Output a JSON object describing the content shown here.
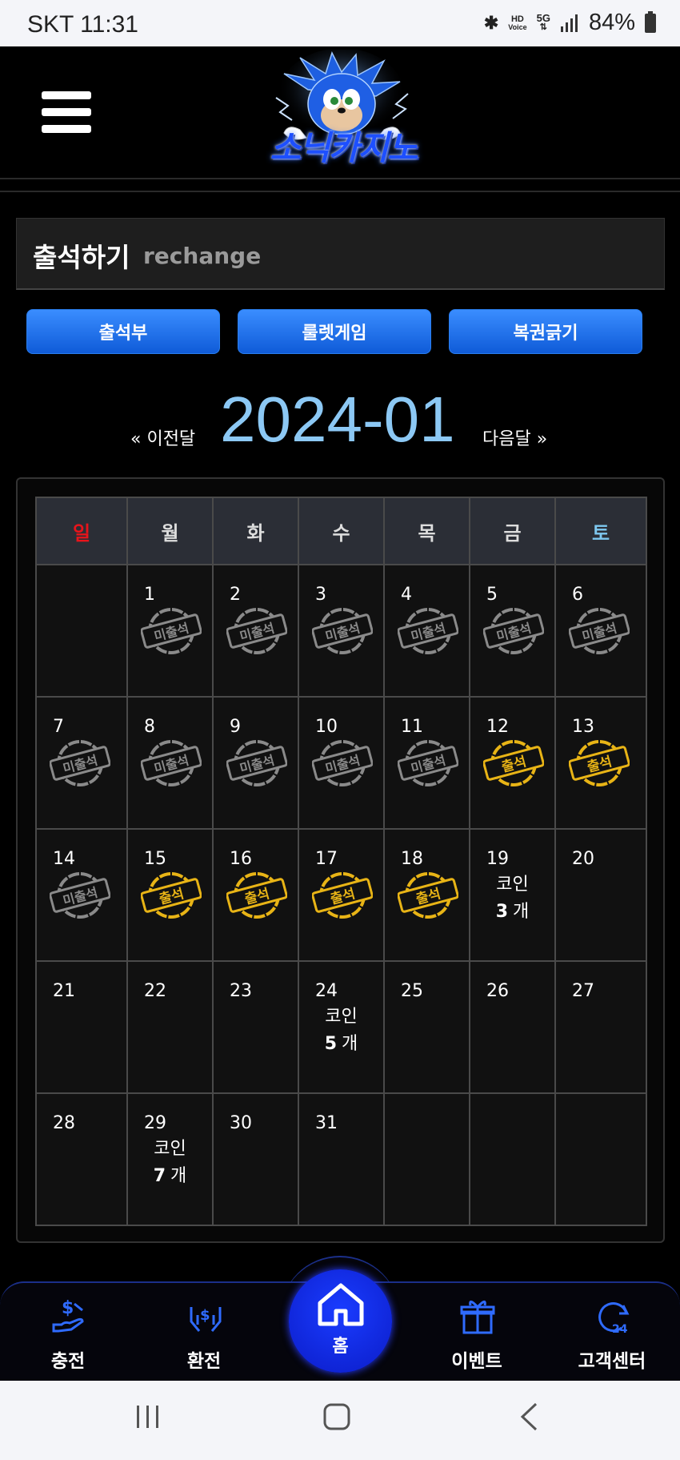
{
  "status_bar": {
    "carrier_time": "SKT 11:31",
    "hd_label": "HD",
    "voice_label": "Voice",
    "net_label": "5G",
    "battery": "84%"
  },
  "header": {
    "logo_text": "소닉카지노"
  },
  "page": {
    "title": "출석하기",
    "subtitle": "rechange"
  },
  "tabs": [
    {
      "label": "출석부"
    },
    {
      "label": "룰렛게임"
    },
    {
      "label": "복권긁기"
    }
  ],
  "month_nav": {
    "prev": "« 이전달",
    "current": "2024-01",
    "next": "다음달 »"
  },
  "calendar": {
    "weekdays": [
      "일",
      "월",
      "화",
      "수",
      "목",
      "금",
      "토"
    ],
    "weekday_colors": {
      "sun": "#e8141b",
      "sat": "#7ec8f0"
    },
    "stamp_absent_label": "미출석",
    "stamp_present_label": "출석",
    "coin_label": "코인",
    "coin_unit": "개",
    "weeks": [
      [
        {
          "day": ""
        },
        {
          "day": "1",
          "stamp": "absent"
        },
        {
          "day": "2",
          "stamp": "absent"
        },
        {
          "day": "3",
          "stamp": "absent"
        },
        {
          "day": "4",
          "stamp": "absent"
        },
        {
          "day": "5",
          "stamp": "absent"
        },
        {
          "day": "6",
          "stamp": "absent"
        }
      ],
      [
        {
          "day": "7",
          "stamp": "absent"
        },
        {
          "day": "8",
          "stamp": "absent"
        },
        {
          "day": "9",
          "stamp": "absent"
        },
        {
          "day": "10",
          "stamp": "absent"
        },
        {
          "day": "11",
          "stamp": "absent"
        },
        {
          "day": "12",
          "stamp": "present"
        },
        {
          "day": "13",
          "stamp": "present"
        }
      ],
      [
        {
          "day": "14",
          "stamp": "absent"
        },
        {
          "day": "15",
          "stamp": "present"
        },
        {
          "day": "16",
          "stamp": "present"
        },
        {
          "day": "17",
          "stamp": "present"
        },
        {
          "day": "18",
          "stamp": "present"
        },
        {
          "day": "19",
          "coins": "3"
        },
        {
          "day": "20"
        }
      ],
      [
        {
          "day": "21"
        },
        {
          "day": "22"
        },
        {
          "day": "23"
        },
        {
          "day": "24",
          "coins": "5"
        },
        {
          "day": "25"
        },
        {
          "day": "26"
        },
        {
          "day": "27"
        }
      ],
      [
        {
          "day": "28"
        },
        {
          "day": "29",
          "coins": "7"
        },
        {
          "day": "30"
        },
        {
          "day": "31"
        },
        {
          "day": ""
        },
        {
          "day": ""
        },
        {
          "day": ""
        }
      ]
    ]
  },
  "bottom_nav": {
    "charge": "충전",
    "exchange": "환전",
    "home": "홈",
    "event": "이벤트",
    "support": "고객센터"
  },
  "colors": {
    "accent_blue": "#1a3cff",
    "tab_blue": "#1f6fe8",
    "stamp_gold": "#e8b416",
    "stamp_gray": "#8a8a8a"
  }
}
